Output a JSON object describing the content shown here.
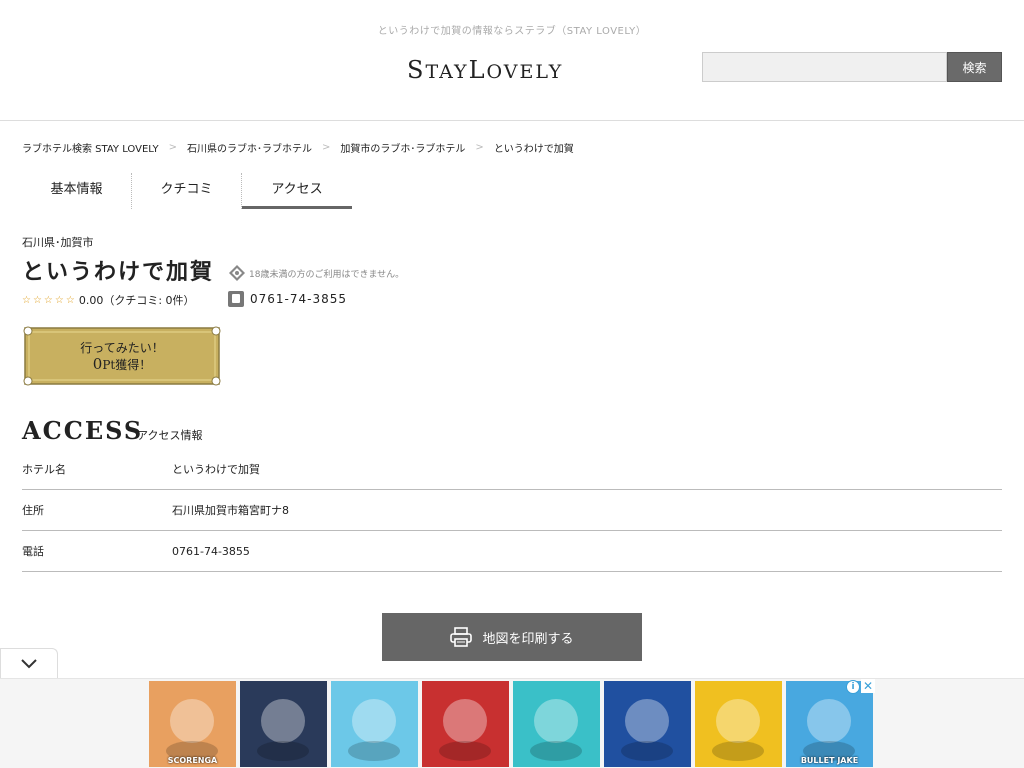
{
  "header": {
    "tagline": "というわけで加賀の情報ならステラブ（STAY LOVELY）",
    "logo_part1": "S",
    "logo_part2": "TAY",
    "logo_part3": "L",
    "logo_part4": "OVELY",
    "search_placeholder": "",
    "search_button": "検索"
  },
  "breadcrumb": [
    "ラブホテル検索 STAY LOVELY",
    "石川県のラブホ･ラブホテル",
    "加賀市のラブホ･ラブホテル",
    "というわけで加賀"
  ],
  "breadcrumb_sep": ">",
  "tabs": [
    "基本情報",
    "クチコミ",
    "アクセス"
  ],
  "hotel": {
    "prefecture": "石川県･加賀市",
    "name": "というわけで加賀",
    "age_note": "18歳未満の方のご利用はできません。",
    "stars": "☆☆☆☆☆",
    "rating_text": "0.00（クチコミ: 0件）",
    "phone": "0761-74-3855"
  },
  "plaque": {
    "line1": "行ってみたい！",
    "points": "0",
    "unit": "Pt",
    "suffix": "獲得！"
  },
  "access": {
    "title": "ACCESS",
    "subtitle": "アクセス情報",
    "rows": [
      {
        "label": "ホテル名",
        "value": "というわけで加賀"
      },
      {
        "label": "住所",
        "value": "石川県加賀市箱宮町ナ8"
      },
      {
        "label": "電話",
        "value": "0761-74-3855"
      }
    ]
  },
  "print_button": "地図を印刷する",
  "ads": {
    "tiles": [
      {
        "label": "SCORENGA",
        "bg": "#e8a060",
        "icon": "runner-game-icon"
      },
      {
        "label": "",
        "bg": "#2a3a5a",
        "icon": "squid-game-icon"
      },
      {
        "label": "",
        "bg": "#6cc8e8",
        "icon": "talking-cat-icon"
      },
      {
        "label": "",
        "bg": "#c83030",
        "icon": "plumber-game-icon"
      },
      {
        "label": "",
        "bg": "#3ac0c8",
        "icon": "cat-mouse-game-icon"
      },
      {
        "label": "",
        "bg": "#2050a0",
        "icon": "crewmate-game-icon"
      },
      {
        "label": "",
        "bg": "#f0c020",
        "icon": "hedgehog-game-icon"
      },
      {
        "label": "BULLET JAKE",
        "bg": "#48a8e0",
        "icon": "adventure-game-icon"
      }
    ],
    "info": "i",
    "close": "✕"
  },
  "colors": {
    "button_gray": "#666666",
    "star_orange": "#e0a020",
    "plaque_gold": "#c8b060"
  }
}
